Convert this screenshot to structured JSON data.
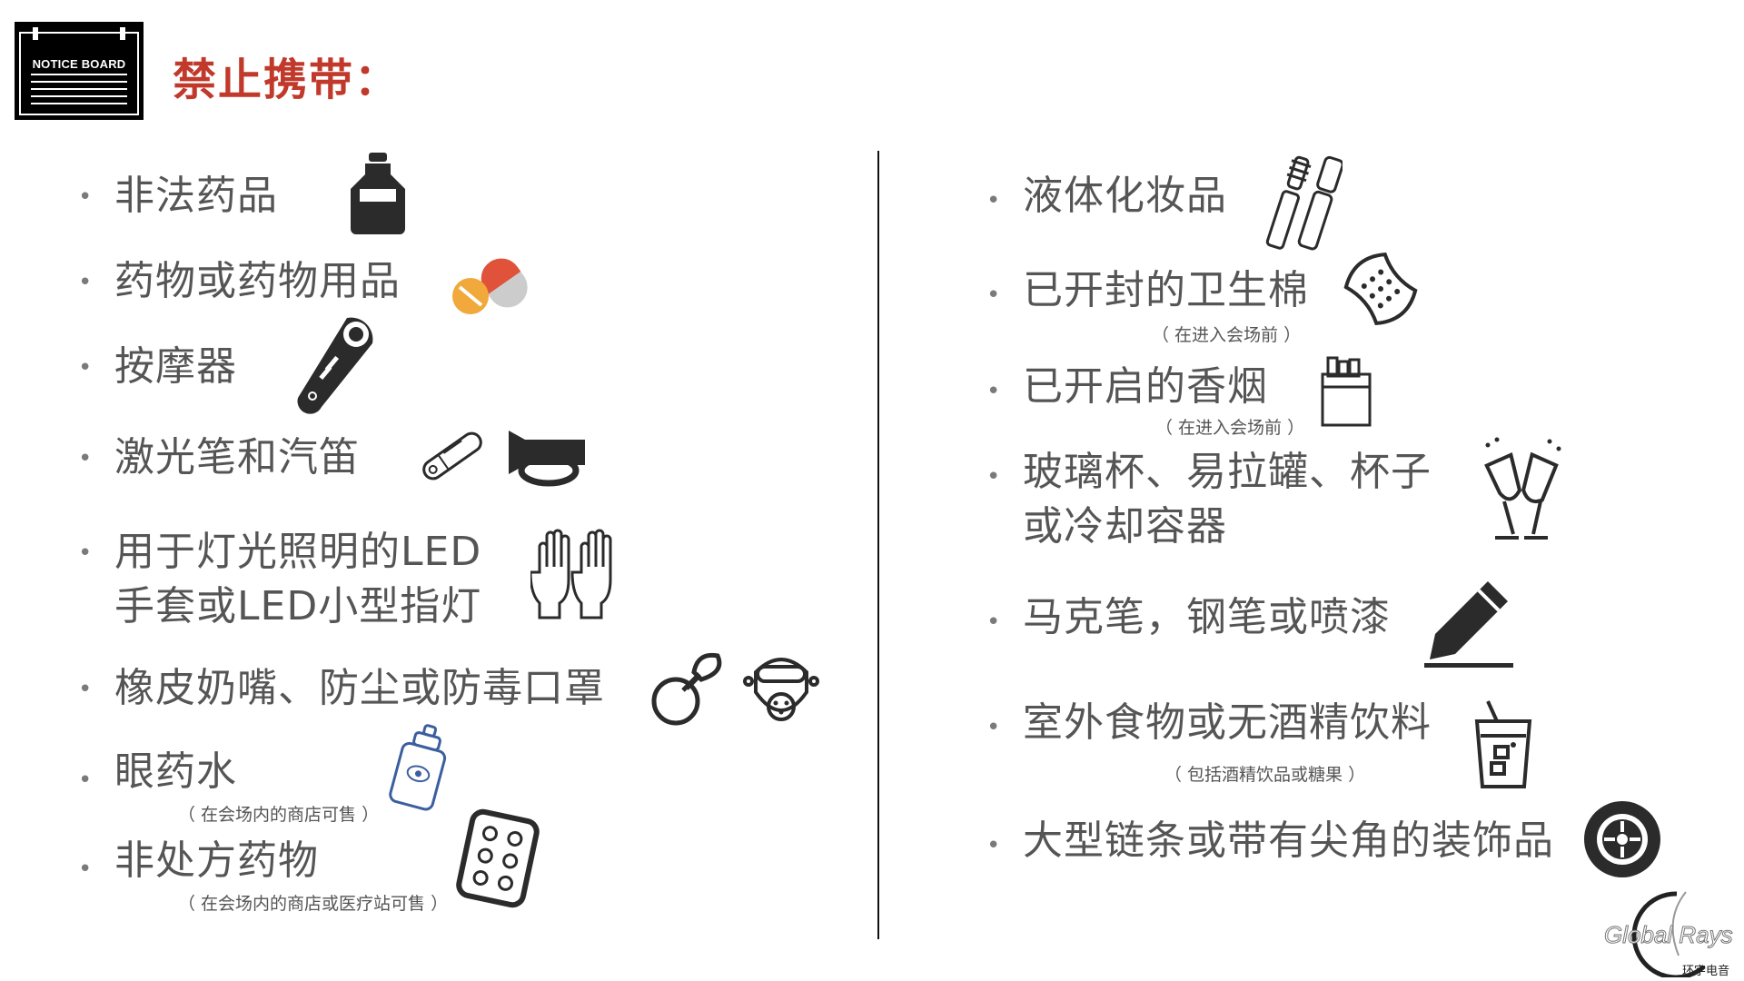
{
  "header": {
    "badge_text": "NOTICE BOARD",
    "title": "禁止携带："
  },
  "left_items": [
    {
      "label": "非法药品",
      "icon": "bottle-icon"
    },
    {
      "label": "药物或药物用品",
      "icon": "pills-icon"
    },
    {
      "label": "按摩器",
      "icon": "massager-icon"
    },
    {
      "label": "激光笔和汽笛",
      "icon": "laser-pen-icon"
    },
    {
      "label_line1": "用于灯光照明的LED",
      "label_line2": "手套或LED小型指灯",
      "icon": "gloves-icon"
    },
    {
      "label": "橡皮奶嘴、防尘或防毒口罩",
      "icon": "pacifier-icon"
    },
    {
      "label": "眼药水",
      "note": "（ 在会场内的商店可售 ）",
      "icon": "eye-drops-icon"
    },
    {
      "label": "非处方药物",
      "note": "（ 在会场内的商店或医疗站可售 ）",
      "icon": "pill-pack-icon"
    }
  ],
  "right_items": [
    {
      "label": "液体化妆品",
      "icon": "mascara-icon"
    },
    {
      "label": "已开封的卫生棉",
      "note": "（ 在进入会场前 ）",
      "icon": "pad-icon"
    },
    {
      "label": "已开启的香烟",
      "note": "（ 在进入会场前 ）",
      "icon": "cigarette-pack-icon"
    },
    {
      "label_line1": "玻璃杯、易拉罐、杯子",
      "label_line2": "或冷却容器",
      "icon": "champagne-glasses-icon"
    },
    {
      "label": "马克笔，钢笔或喷漆",
      "icon": "pencil-icon"
    },
    {
      "label": "室外食物或无酒精饮料",
      "note": "（ 包括酒精饮品或糖果 ）",
      "icon": "soft-drink-icon"
    },
    {
      "label": "大型链条或带有尖角的装饰品",
      "icon": "spiked-wheel-icon"
    }
  ],
  "bullet": "•",
  "logo": {
    "text": "Global Rays",
    "subtext": "环宇电音"
  },
  "colors": {
    "title": "#c0392b",
    "text": "#555555",
    "icon": "#2b2b2b"
  }
}
